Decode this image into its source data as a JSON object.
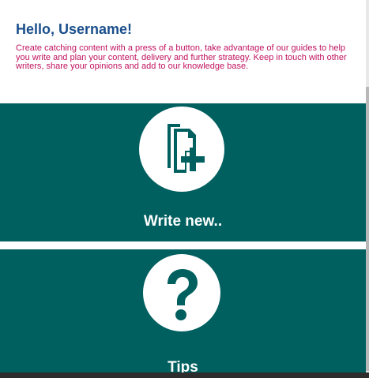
{
  "header": {
    "greeting": "Hello, Username!",
    "intro": "Create catching content with a press of a button, take advantage of our guides to help you write and plan your content, delivery and further strategy. Keep in touch with other writers, share your opinions and add to our knowledge base."
  },
  "tiles": [
    {
      "label": "Write new..",
      "icon": "new-document-icon"
    },
    {
      "label": "Tips",
      "icon": "question-mark-icon"
    }
  ],
  "colors": {
    "tile_background": "#005f5f",
    "greeting": "#1a4f8c",
    "intro": "#c0135f"
  }
}
